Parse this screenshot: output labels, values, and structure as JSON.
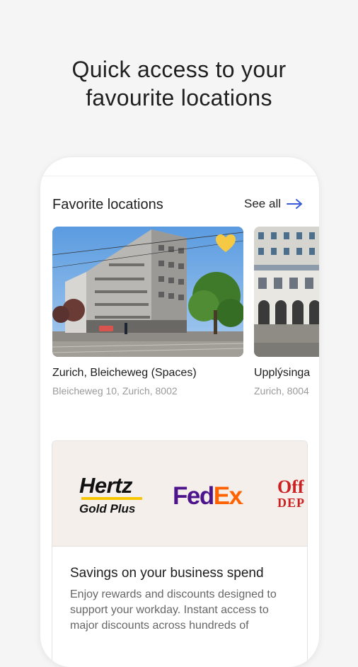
{
  "headline": {
    "line1": "Quick access to your",
    "line2": "favourite locations"
  },
  "favorites": {
    "title": "Favorite locations",
    "see_all_label": "See all",
    "see_all_icon": "arrow-right-icon",
    "accent_color": "#3b5bdb",
    "cards": [
      {
        "name": "Zurich, Bleicheweg (Spaces)",
        "address": "Bleicheweg 10, Zurich, 8002",
        "favorite_icon": "heart-icon",
        "favorite_color": "#f5c944"
      },
      {
        "name": "Upplýsinga",
        "address": "Zurich, 8004"
      }
    ]
  },
  "promo": {
    "partners": {
      "hertz": "Hertz",
      "hertz_tier": "Gold Plus",
      "fedex_fed": "Fed",
      "fedex_ex": "Ex",
      "fedex_dot": ".",
      "office_line1": "Off",
      "office_line2": "DEP"
    },
    "title": "Savings on your business spend",
    "body": "Enjoy rewards and discounts designed to support your workday. Instant access to major discounts across hundreds of"
  }
}
